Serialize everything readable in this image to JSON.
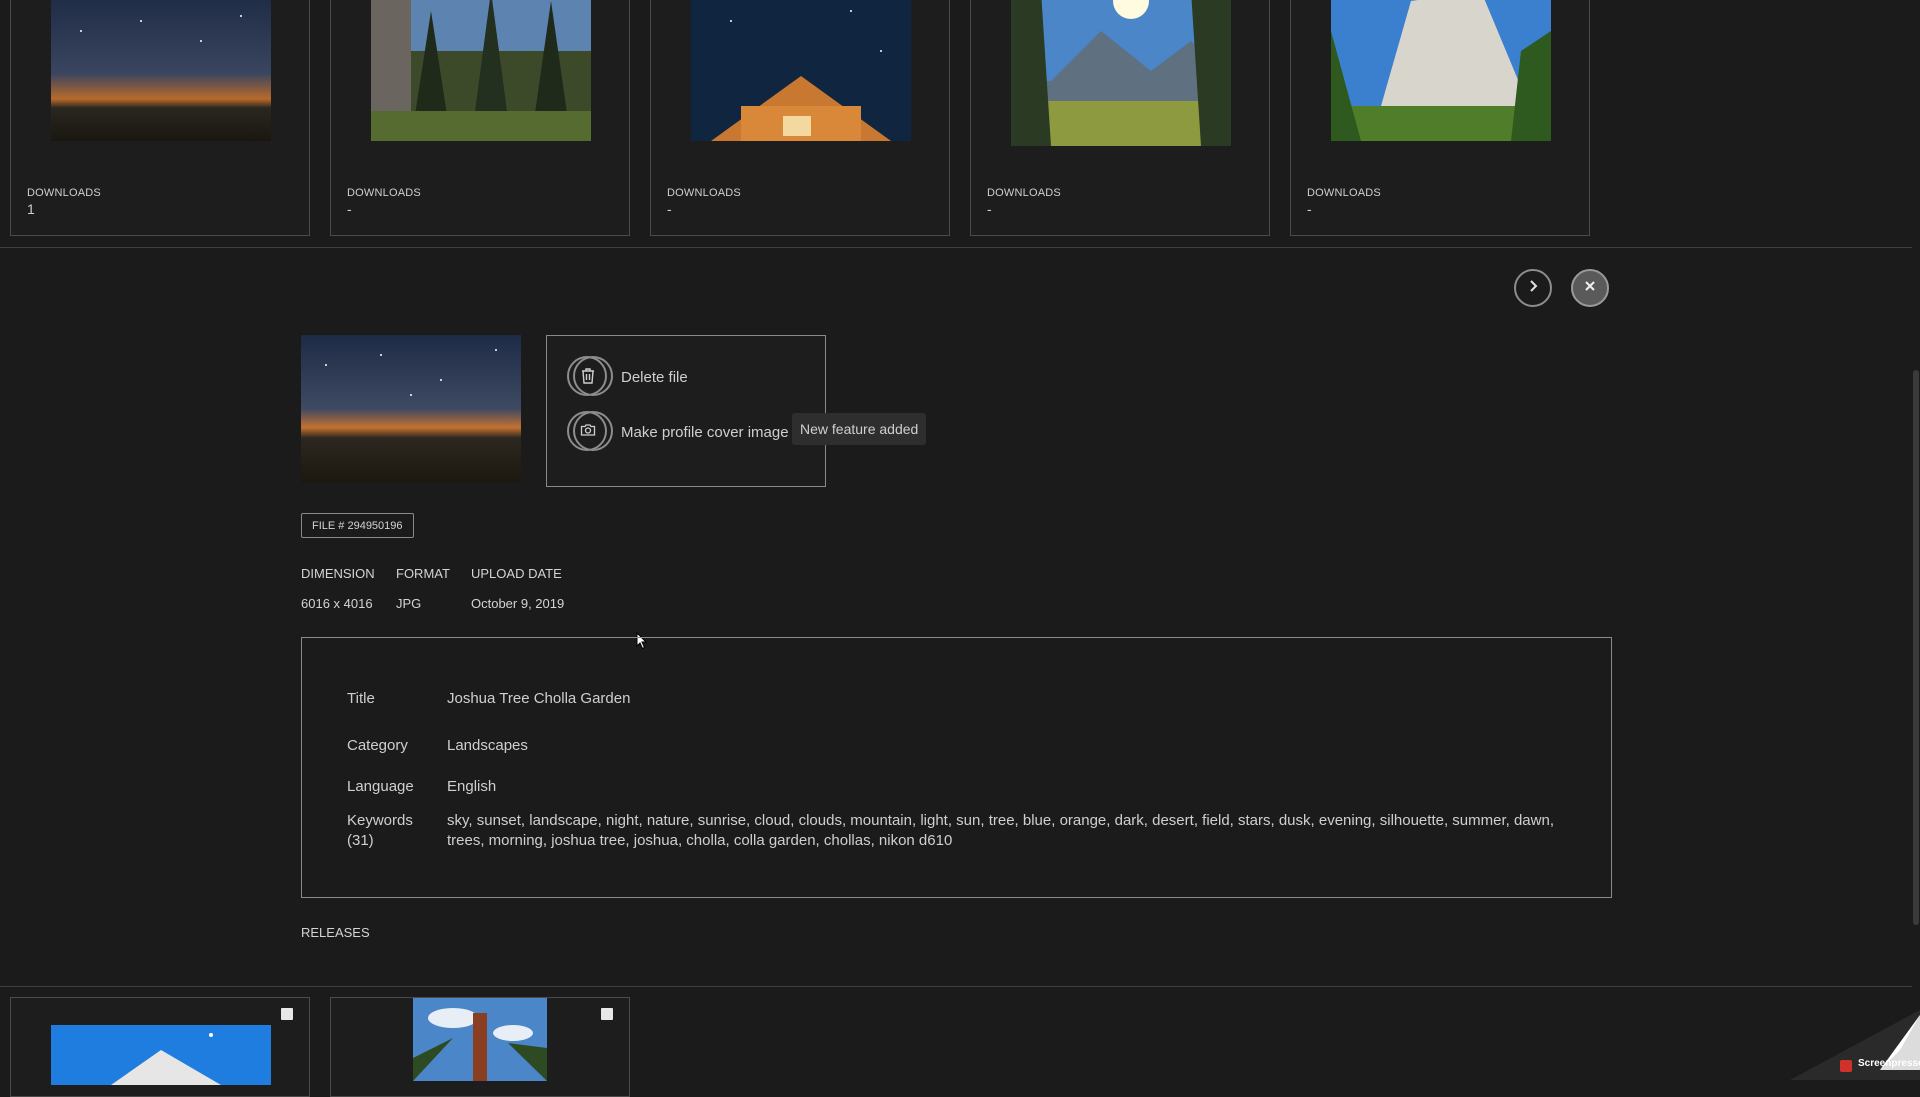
{
  "top_cards": [
    {
      "label": "DOWNLOADS",
      "value": "1"
    },
    {
      "label": "DOWNLOADS",
      "value": "-"
    },
    {
      "label": "DOWNLOADS",
      "value": "-"
    },
    {
      "label": "DOWNLOADS",
      "value": "-"
    },
    {
      "label": "DOWNLOADS",
      "value": "-"
    }
  ],
  "nav": {
    "next_icon": "chevron-right-icon",
    "close_icon": "close-icon"
  },
  "actions": {
    "delete_label": "Delete file",
    "cover_label": "Make profile cover image",
    "tooltip": "New feature added"
  },
  "file": {
    "badge": "FILE # 294950196",
    "dimension_label": "DIMENSION",
    "format_label": "FORMAT",
    "upload_label": "UPLOAD DATE",
    "dimension": "6016 x 4016",
    "format": "JPG",
    "upload_date": "October 9, 2019"
  },
  "details": {
    "title_label": "Title",
    "title": "Joshua Tree Cholla Garden",
    "category_label": "Category",
    "category": "Landscapes",
    "language_label": "Language",
    "language": "English",
    "keywords_label": "Keywords",
    "keywords_count": "(31)",
    "keywords_line1": "sky, sunset, landscape, night, nature, sunrise, cloud, clouds, mountain, light, sun, tree, blue, orange, dark, desert, field, stars, dusk, evening, silhouette, summer, dawn,",
    "keywords_line2": "trees, morning, joshua tree, joshua, cholla, colla garden, chollas, nikon d610"
  },
  "releases_label": "RELEASES",
  "watermark": "Screenpresso"
}
